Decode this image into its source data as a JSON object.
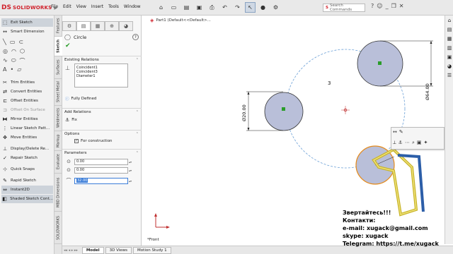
{
  "app": {
    "logo_ds": "DS",
    "logo_name": "SOLIDWORKS"
  },
  "menus": [
    "File",
    "Edit",
    "View",
    "Insert",
    "Tools",
    "Window"
  ],
  "search": {
    "placeholder": "Search Commands"
  },
  "command_manager": {
    "items": [
      {
        "label": "Exit Sketch",
        "icon": "exit-sketch-icon",
        "state": "highlighted"
      },
      {
        "label": "Smart Dimension",
        "icon": "smart-dimension-icon",
        "state": "normal"
      },
      {
        "label": "Trim Entities",
        "icon": "trim-icon",
        "state": "normal"
      },
      {
        "label": "Convert Entities",
        "icon": "convert-icon",
        "state": "normal"
      },
      {
        "label": "Offset Entities",
        "icon": "offset-icon",
        "state": "normal"
      },
      {
        "label": "Offset On Surface",
        "icon": "offset-surface-icon",
        "state": "disabled"
      },
      {
        "label": "Mirror Entities",
        "icon": "mirror-icon",
        "state": "normal"
      },
      {
        "label": "Linear Sketch Patt...",
        "icon": "linear-pattern-icon",
        "state": "normal"
      },
      {
        "label": "Move Entities",
        "icon": "move-icon",
        "state": "normal"
      },
      {
        "label": "Display/Delete Re...",
        "icon": "relations-icon",
        "state": "normal"
      },
      {
        "label": "Repair Sketch",
        "icon": "repair-icon",
        "state": "normal"
      },
      {
        "label": "Quick Snaps",
        "icon": "snaps-icon",
        "state": "normal"
      },
      {
        "label": "Rapid Sketch",
        "icon": "rapid-sketch-icon",
        "state": "normal"
      },
      {
        "label": "Instant2D",
        "icon": "instant2d-icon",
        "state": "highlighted"
      },
      {
        "label": "Shaded Sketch Cont...",
        "icon": "shaded-icon",
        "state": "highlighted"
      }
    ]
  },
  "vertical_tabs": [
    "Features",
    "Sketch",
    "Surfaces",
    "Sheet Metal",
    "Weldments",
    "Markup",
    "Evaluate",
    "MBD Dimensions",
    "SOLIDWORKS"
  ],
  "property_manager": {
    "title": "Circle",
    "help": "?",
    "sections": {
      "existing_relations": "Existing Relations",
      "add_relations": "Add Relations",
      "options": "Options",
      "parameters": "Parameters"
    },
    "relations": [
      "Coincident1",
      "Coincident3",
      "Diameter1"
    ],
    "status": "Fully Defined",
    "add_relation_item": "Fix",
    "for_construction": "For construction",
    "params": {
      "x": "0.00",
      "y": "0.00",
      "radius": "32.00"
    }
  },
  "viewport": {
    "breadcrumb": "Part1  (Default<<Default>...",
    "view_label": "*Front",
    "dimension_left": "Ø20.00",
    "dimension_right": "Ø64.00",
    "label_3": "3"
  },
  "bottom_tabs": [
    "Model",
    "3D Views",
    "Motion Study 1"
  ],
  "overlay": {
    "lines": [
      "Звертайтесь!!!",
      "Контакти:",
      "e-mail: xugack@gmail.com",
      "skype: xugack",
      "Telegram: https://t.me/xugack"
    ]
  },
  "colors": {
    "accent": "#d0202a",
    "circle_fill": "#b9bfd9",
    "construction": "#6a9fd6",
    "selected": "#e58a1a"
  }
}
